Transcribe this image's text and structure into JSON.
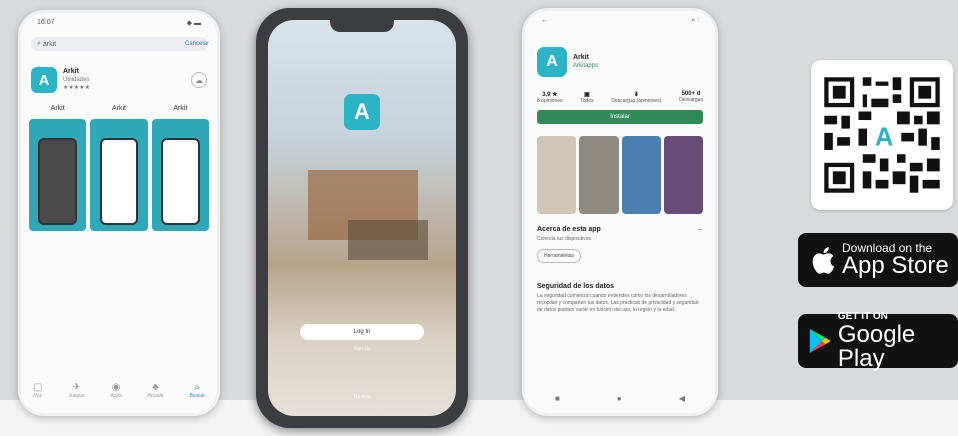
{
  "ios": {
    "status_time": "16:07",
    "status_icons": "◆ ▬",
    "search_text": "arkit",
    "cancel_label": "Cancelar",
    "app_name": "Arkit",
    "app_dev": "Utilidades",
    "stars": "★★★★★",
    "shot_labels": [
      "Arkit",
      "Arkit",
      "Arkit"
    ],
    "tabs": [
      {
        "icon": "▢",
        "label": "Hoy"
      },
      {
        "icon": "✈",
        "label": "Juegos"
      },
      {
        "icon": "◉",
        "label": "Apps"
      },
      {
        "icon": "♣",
        "label": "Arcade"
      },
      {
        "icon": "⌕",
        "label": "Buscar"
      }
    ]
  },
  "splash": {
    "logo_glyph": "A",
    "login_label": "Log In",
    "signup_label": "Sign Up",
    "try_label": "Try now"
  },
  "play": {
    "status_left": "←",
    "status_right": "⌕  ⋮",
    "app_name": "Arkit",
    "app_dev": "Arkitapps",
    "stats": [
      {
        "value": "3,9 ★",
        "label": "8 opiniones"
      },
      {
        "value": "▣",
        "label": "Todos"
      },
      {
        "value": "⬇",
        "label": "Descargas (opiniones)"
      },
      {
        "value": "500+ d",
        "label": "Descargas"
      }
    ],
    "install_label": "Instalar",
    "about_title": "Acerca de esta app",
    "about_arrow": "→",
    "about_text": "Conecta tus dispositivos",
    "chip_label": "Herramientas",
    "security_title": "Seguridad de los datos",
    "security_text": "La seguridad comienza cuando entiendes cómo los desarrolladores recopilan y comparten tus datos. Las prácticas de privacidad y seguridad de datos pueden variar en función del uso, la región y la edad.",
    "nav": [
      "■",
      "●",
      "◀"
    ]
  },
  "badges": {
    "apple_small": "Download on the",
    "apple_big": "App Store",
    "google_small": "GET IT ON",
    "google_big": "Google Play"
  },
  "colors": {
    "brand": "#2bb4c6",
    "install": "#2e8b57"
  }
}
